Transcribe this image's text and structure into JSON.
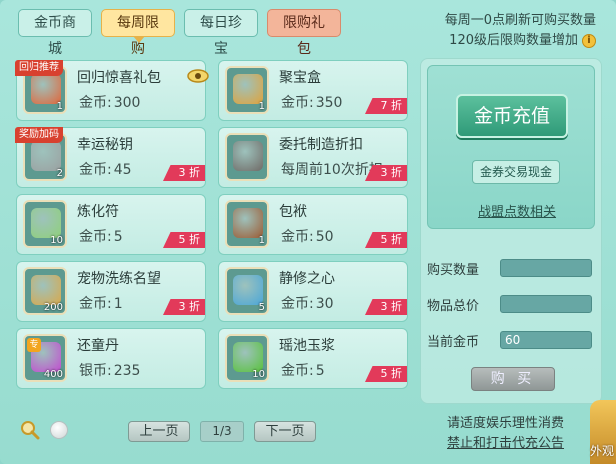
{
  "tabs": [
    {
      "label": "金币商城"
    },
    {
      "label": "每周限购"
    },
    {
      "label": "每日珍宝"
    },
    {
      "label": "限购礼包"
    }
  ],
  "info": {
    "line1": "每周一0点刷新可购买数量",
    "line2": "120级后限购数量增加",
    "info_icon_glyph": "i"
  },
  "items": [
    {
      "name": "回归惊喜礼包",
      "currency": "金币:",
      "price": "300",
      "qty": "1",
      "badge": "回归推荐",
      "discount": "",
      "icon": "gift-box-icon",
      "color": "#e0663a"
    },
    {
      "name": "聚宝盒",
      "currency": "金币:",
      "price": "350",
      "qty": "1",
      "badge": "",
      "discount": "7 折",
      "icon": "treasure-box-icon",
      "color": "#e0a23a"
    },
    {
      "name": "幸运秘钥",
      "currency": "金币:",
      "price": "45",
      "qty": "2",
      "badge": "奖励加码",
      "discount": "3 折",
      "icon": "key-icon",
      "color": "#9aa0a0"
    },
    {
      "name": "委托制造折扣",
      "currency": "每周前10次折扣",
      "price": "",
      "qty": "",
      "badge": "",
      "discount": "3 折",
      "icon": "hammer-icon",
      "color": "#6f6a66"
    },
    {
      "name": "炼化符",
      "currency": "金币:",
      "price": "5",
      "qty": "10",
      "badge": "",
      "discount": "5 折",
      "icon": "talisman-icon",
      "color": "#8fd07a"
    },
    {
      "name": "包袱",
      "currency": "金币:",
      "price": "50",
      "qty": "1",
      "badge": "",
      "discount": "5 折",
      "icon": "bag-icon",
      "color": "#9c5a32"
    },
    {
      "name": "宠物洗练名望",
      "currency": "金币:",
      "price": "1",
      "qty": "200",
      "badge": "",
      "discount": "3 折",
      "icon": "paw-scroll-icon",
      "color": "#d9a84a"
    },
    {
      "name": "静修之心",
      "currency": "金币:",
      "price": "30",
      "qty": "5",
      "badge": "",
      "discount": "3 折",
      "icon": "heart-gem-icon",
      "color": "#4aa6d8"
    },
    {
      "name": "还童丹",
      "currency": "银币:",
      "price": "235",
      "qty": "400",
      "badge": "专",
      "discount": "",
      "icon": "pill-icon",
      "color": "#c24ad0"
    },
    {
      "name": "瑶池玉浆",
      "currency": "金币:",
      "price": "5",
      "qty": "10",
      "badge": "",
      "discount": "5 折",
      "icon": "jade-jar-icon",
      "color": "#58c23a"
    }
  ],
  "panel": {
    "recharge": "金币充值",
    "exchange": "金券交易现金",
    "alliance": "战盟点数相关",
    "qty_label": "购买数量",
    "total_label": "物品总价",
    "gold_label": "当前金币",
    "qty_value": "",
    "total_value": "",
    "gold_value": "60",
    "buy": "购 买"
  },
  "pager": {
    "prev": "上一页",
    "page": "1/3",
    "next": "下一页"
  },
  "notice": {
    "line1": "请适度娱乐理性消费",
    "line2": "禁止和打击代充公告"
  },
  "corner": {
    "label": "外观"
  }
}
